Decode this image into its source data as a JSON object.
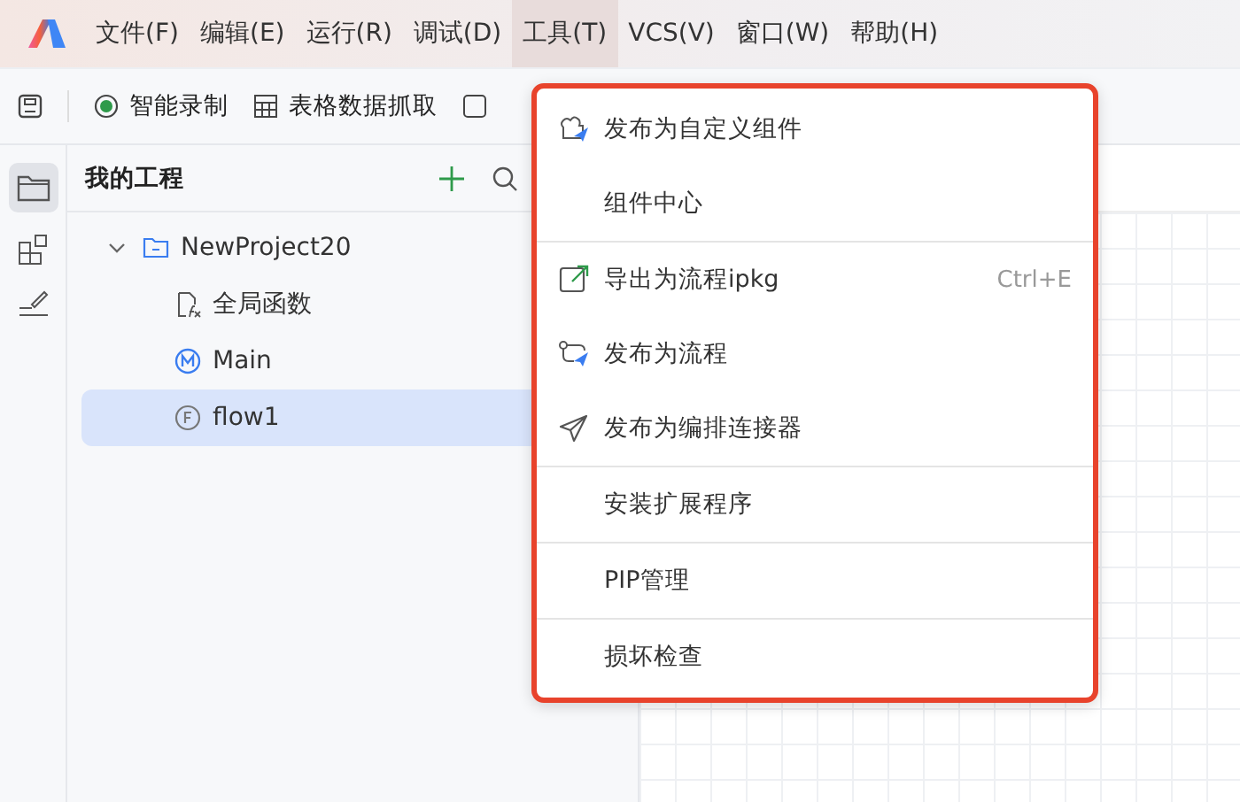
{
  "menubar": [
    {
      "label": "文件(F)",
      "selected": false
    },
    {
      "label": "编辑(E)",
      "selected": false
    },
    {
      "label": "运行(R)",
      "selected": false
    },
    {
      "label": "调试(D)",
      "selected": false
    },
    {
      "label": "工具(T)",
      "selected": true
    },
    {
      "label": "VCS(V)",
      "selected": false
    },
    {
      "label": "窗口(W)",
      "selected": false
    },
    {
      "label": "帮助(H)",
      "selected": false
    }
  ],
  "toolbar": [
    {
      "kind": "record",
      "label": "智能录制"
    },
    {
      "kind": "table",
      "label": "表格数据抓取"
    }
  ],
  "sidebar": {
    "title": "我的工程",
    "tree": [
      {
        "kind": "folder",
        "label": "NewProject20",
        "expanded": true,
        "selected": false,
        "children": [
          {
            "kind": "functions",
            "label": "全局函数",
            "selected": false
          },
          {
            "kind": "main",
            "label": "Main",
            "selected": false
          },
          {
            "kind": "flow",
            "label": "flow1",
            "selected": true
          }
        ]
      }
    ]
  },
  "menu": {
    "groups": [
      [
        {
          "kind": "component",
          "label": "发布为自定义组件"
        },
        {
          "kind": "plain",
          "label": "组件中心"
        }
      ],
      [
        {
          "kind": "export",
          "label": "导出为流程ipkg",
          "shortcut": "Ctrl+E"
        },
        {
          "kind": "flow",
          "label": "发布为流程"
        },
        {
          "kind": "connector",
          "label": "发布为编排连接器"
        }
      ],
      [
        {
          "kind": "plain",
          "label": "安装扩展程序"
        }
      ],
      [
        {
          "kind": "plain",
          "label": "PIP管理"
        }
      ],
      [
        {
          "kind": "plain",
          "label": "损坏检查"
        }
      ]
    ]
  }
}
